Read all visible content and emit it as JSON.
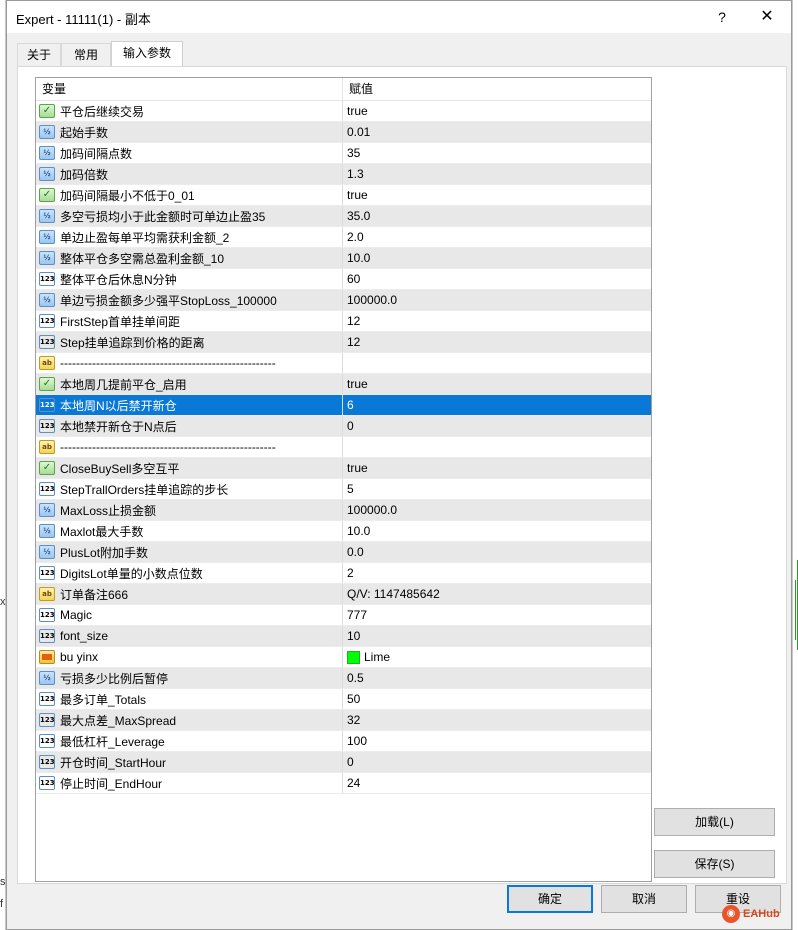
{
  "window": {
    "title": "Expert - 11111(1) - 副本",
    "help": "?",
    "close": "✕"
  },
  "tabs": [
    {
      "label": "关于"
    },
    {
      "label": "常用"
    },
    {
      "label": "输入参数"
    }
  ],
  "table": {
    "headers": {
      "variable": "变量",
      "value": "赋值"
    },
    "rows": [
      {
        "type": "bool",
        "icon": "bool-icon",
        "name": "平仓后继续交易",
        "value": "true"
      },
      {
        "type": "frac",
        "icon": "double-icon",
        "name": "起始手数",
        "value": "0.01"
      },
      {
        "type": "frac",
        "icon": "double-icon",
        "name": "加码间隔点数",
        "value": "35"
      },
      {
        "type": "frac",
        "icon": "double-icon",
        "name": "加码倍数",
        "value": "1.3"
      },
      {
        "type": "bool",
        "icon": "bool-icon",
        "name": "加码间隔最小不低于0_01",
        "value": "true"
      },
      {
        "type": "frac",
        "icon": "double-icon",
        "name": "多空亏损均小于此金额时可单边止盈35",
        "value": "35.0"
      },
      {
        "type": "frac",
        "icon": "double-icon",
        "name": "单边止盈每单平均需获利金额_2",
        "value": "2.0"
      },
      {
        "type": "frac",
        "icon": "double-icon",
        "name": "整体平仓多空需总盈利金额_10",
        "value": "10.0"
      },
      {
        "type": "int",
        "icon": "int-icon",
        "name": "整体平仓后休息N分钟",
        "value": "60"
      },
      {
        "type": "frac",
        "icon": "double-icon",
        "name": "单边亏损金额多少强平StopLoss_100000",
        "value": "100000.0"
      },
      {
        "type": "int",
        "icon": "int-icon",
        "name": "FirstStep首单挂单间距",
        "value": "12"
      },
      {
        "type": "int",
        "icon": "int-icon",
        "name": "Step挂单追踪到价格的距离",
        "value": "12"
      },
      {
        "type": "str",
        "icon": "string-icon",
        "name": "------------------------------------------------------",
        "value": ""
      },
      {
        "type": "bool",
        "icon": "bool-icon",
        "name": "本地周几提前平仓_启用",
        "value": "true"
      },
      {
        "type": "int",
        "icon": "int-icon",
        "name": "本地周N以后禁开新仓",
        "value": "6",
        "selected": true
      },
      {
        "type": "int",
        "icon": "int-icon",
        "name": "本地禁开新仓于N点后",
        "value": "0"
      },
      {
        "type": "str",
        "icon": "string-icon",
        "name": "------------------------------------------------------",
        "value": ""
      },
      {
        "type": "bool",
        "icon": "bool-icon",
        "name": "CloseBuySell多空互平",
        "value": "true"
      },
      {
        "type": "int",
        "icon": "int-icon",
        "name": "StepTrallOrders挂单追踪的步长",
        "value": "5"
      },
      {
        "type": "frac",
        "icon": "double-icon",
        "name": "MaxLoss止损金额",
        "value": "100000.0"
      },
      {
        "type": "frac",
        "icon": "double-icon",
        "name": "Maxlot最大手数",
        "value": "10.0"
      },
      {
        "type": "frac",
        "icon": "double-icon",
        "name": "PlusLot附加手数",
        "value": "0.0"
      },
      {
        "type": "int",
        "icon": "int-icon",
        "name": "DigitsLot单量的小数点位数",
        "value": "2"
      },
      {
        "type": "str",
        "icon": "string-icon",
        "name": "订单备注666",
        "value": "Q/V:  1147485642"
      },
      {
        "type": "int",
        "icon": "int-icon",
        "name": "Magic",
        "value": "777"
      },
      {
        "type": "int",
        "icon": "int-icon",
        "name": "font_size",
        "value": "10"
      },
      {
        "type": "color",
        "icon": "color-icon",
        "name": "bu yinx",
        "value": "Lime",
        "swatch": "#00ff00"
      },
      {
        "type": "frac",
        "icon": "double-icon",
        "name": "亏损多少比例后暂停",
        "value": "0.5"
      },
      {
        "type": "int",
        "icon": "int-icon",
        "name": "最多订单_Totals",
        "value": "50"
      },
      {
        "type": "int",
        "icon": "int-icon",
        "name": "最大点差_MaxSpread",
        "value": "32"
      },
      {
        "type": "int",
        "icon": "int-icon",
        "name": "最低杠杆_Leverage",
        "value": "100"
      },
      {
        "type": "int",
        "icon": "int-icon",
        "name": "开仓时间_StartHour",
        "value": "0"
      },
      {
        "type": "int",
        "icon": "int-icon",
        "name": "停止时间_EndHour",
        "value": "24"
      }
    ]
  },
  "side_buttons": {
    "load": "加载(L)",
    "save": "保存(S)"
  },
  "footer": {
    "ok": "确定",
    "cancel": "取消",
    "reset": "重设"
  },
  "icon_labels": {
    "int": "123",
    "frac": "½",
    "bool": "✓",
    "str": "ab"
  },
  "watermark": "EAHub",
  "bg_marks": [
    "x",
    "s)",
    "f"
  ]
}
